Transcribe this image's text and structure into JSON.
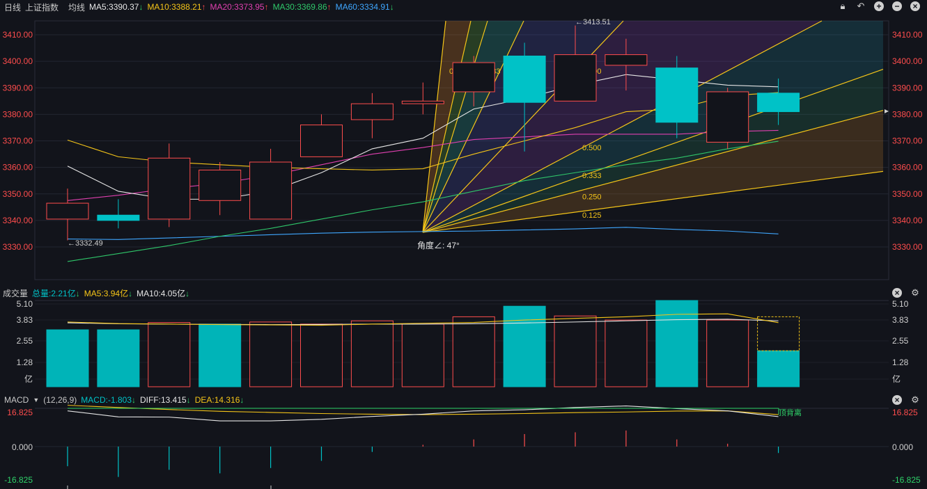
{
  "header": {
    "period": "日线",
    "index_name": "上证指数",
    "ma_label": "均线",
    "ma_items": [
      {
        "text": "MA5:3390.37",
        "arrow": "↓",
        "color": "#e6e6e6",
        "arrow_color": "#2fd36a"
      },
      {
        "text": "MA10:3388.21",
        "arrow": "↑",
        "color": "#f5c518",
        "arrow_color": "#ff4d4d"
      },
      {
        "text": "MA20:3373.95",
        "arrow": "↑",
        "color": "#e040b0",
        "arrow_color": "#ff4d4d"
      },
      {
        "text": "MA30:3369.86",
        "arrow": "↑",
        "color": "#2fc76a",
        "arrow_color": "#ff4d4d"
      },
      {
        "text": "MA60:3334.91",
        "arrow": "↓",
        "color": "#3fa7ff",
        "arrow_color": "#2fd36a"
      }
    ],
    "icons": [
      "lock-icon",
      "undo-icon",
      "zoom-in-icon",
      "zoom-out-icon",
      "close-icon"
    ]
  },
  "volume_header": {
    "label": "成交量",
    "items": [
      {
        "text": "总量:2.21亿",
        "arrow": "↓",
        "color": "#00c2c7"
      },
      {
        "text": "MA5:3.94亿",
        "arrow": "↓",
        "color": "#f5c518"
      },
      {
        "text": "MA10:4.05亿",
        "arrow": "↓",
        "color": "#e6e6e6"
      }
    ]
  },
  "macd_header": {
    "label": "MACD",
    "params": "(12,26,9)",
    "items": [
      {
        "text": "MACD:-1.803",
        "arrow": "↓",
        "color": "#00c2c7"
      },
      {
        "text": "DIFF:13.415",
        "arrow": "↓",
        "color": "#e6e6e6"
      },
      {
        "text": "DEA:14.316",
        "arrow": "↓",
        "color": "#f5c518"
      }
    ]
  },
  "chart_data": [
    {
      "type": "candlestick",
      "yticks": [
        "3410.00",
        "3400.00",
        "3390.00",
        "3380.00",
        "3370.00",
        "3360.00",
        "3350.00",
        "3340.00",
        "3330.00"
      ],
      "ylim": [
        3322,
        3418
      ],
      "candles": [
        {
          "o": 3340.5,
          "h": 3352,
          "l": 3332.5,
          "c": 3346.5
        },
        {
          "o": 3342,
          "h": 3348,
          "l": 3337,
          "c": 3340
        },
        {
          "o": 3340.5,
          "h": 3369,
          "l": 3337.5,
          "c": 3363.5
        },
        {
          "o": 3347.5,
          "h": 3362,
          "l": 3342,
          "c": 3359
        },
        {
          "o": 3340.5,
          "h": 3367,
          "l": 3340.5,
          "c": 3362
        },
        {
          "o": 3364,
          "h": 3380,
          "l": 3364,
          "c": 3376
        },
        {
          "o": 3378,
          "h": 3388,
          "l": 3371,
          "c": 3384
        },
        {
          "o": 3384,
          "h": 3392,
          "l": 3380,
          "c": 3385
        },
        {
          "o": 3388.5,
          "h": 3402,
          "l": 3383,
          "c": 3399.5
        },
        {
          "o": 3402,
          "h": 3407,
          "l": 3366,
          "c": 3384.5
        },
        {
          "o": 3385,
          "h": 3413.51,
          "l": 3385,
          "c": 3402.5
        },
        {
          "o": 3398.5,
          "h": 3408.5,
          "l": 3389,
          "c": 3402.5
        },
        {
          "o": 3397.5,
          "h": 3402,
          "l": 3371,
          "c": 3377
        },
        {
          "o": 3369.5,
          "h": 3390,
          "l": 3367,
          "c": 3388.5
        },
        {
          "o": 3388,
          "h": 3393.5,
          "l": 3376,
          "c": 3381
        }
      ],
      "ma5": [
        3360.5,
        3351,
        3348,
        3348,
        3351,
        3358,
        3367,
        3371,
        3382,
        3386,
        3391,
        3395,
        3393,
        3391,
        3390.37
      ],
      "ma10": [
        3370.3,
        3364,
        3362,
        3361,
        3360,
        3359.5,
        3359,
        3359.5,
        3365,
        3370,
        3375,
        3381,
        3382,
        3387,
        3388.21
      ],
      "ma20_start": [
        0,
        3347.5
      ],
      "ma20_end": [
        14,
        3374
      ],
      "ma20": [
        3347.5,
        3349.5,
        3352,
        3354,
        3357,
        3361,
        3365,
        3367.5,
        3370.5,
        3371.5,
        3372.5,
        3372.5,
        3372.5,
        3373.5,
        3373.95
      ],
      "ma30": [
        3324.5,
        3327.5,
        3330.5,
        3334,
        3337,
        3340.5,
        3344,
        3347,
        3351,
        3355,
        3358,
        3361,
        3363.5,
        3367,
        3369.86
      ],
      "ma60": [
        3333,
        3332.8,
        3333.4,
        3334,
        3334.6,
        3335.2,
        3335.6,
        3335.8,
        3336,
        3336.4,
        3336.8,
        3337.4,
        3336.6,
        3336,
        3334.91
      ],
      "annotations": {
        "high_label": "←3413.51",
        "low_label": "←3332.49",
        "angle_label": "角度∠: 47°",
        "fan_labels": [
          "0.125",
          "0.250",
          "0.333",
          "0.500",
          "1.000"
        ],
        "fan_labels_right": [
          "0.500",
          "0.333",
          "0.250",
          "0.125"
        ]
      }
    },
    {
      "type": "bar",
      "title": "成交量",
      "yticks": [
        "5.10",
        "3.83",
        "2.55",
        "1.28",
        "亿"
      ],
      "ylim": [
        0,
        5.3
      ],
      "values": [
        3.5,
        3.5,
        3.95,
        3.85,
        3.98,
        3.85,
        4.05,
        3.85,
        4.3,
        4.95,
        4.35,
        4.1,
        5.3,
        4.1,
        2.21
      ],
      "up": [
        false,
        false,
        true,
        false,
        true,
        true,
        true,
        true,
        true,
        false,
        true,
        true,
        false,
        true,
        false
      ],
      "ma5": [
        3.98,
        3.88,
        3.85,
        3.82,
        3.8,
        3.78,
        3.85,
        3.9,
        3.95,
        4.1,
        4.2,
        4.3,
        4.45,
        4.48,
        3.94
      ],
      "ma10": [
        3.93,
        3.87,
        3.85,
        3.83,
        3.82,
        3.83,
        3.85,
        3.85,
        3.87,
        3.92,
        3.98,
        4.05,
        4.12,
        4.15,
        4.05
      ]
    },
    {
      "type": "macd",
      "yticks": [
        "16.825",
        "0.000",
        "-16.825"
      ],
      "ylim": [
        -16.825,
        16.825
      ],
      "diff": [
        16.0,
        13.3,
        13.2,
        11.5,
        11.5,
        12.2,
        13.5,
        14.5,
        16.0,
        16.5,
        17.5,
        18.2,
        17.0,
        16.0,
        13.415
      ],
      "dea": [
        18.5,
        17.5,
        16.6,
        15.8,
        15.3,
        14.8,
        14.5,
        14.3,
        14.5,
        14.8,
        15.2,
        15.5,
        15.9,
        16.0,
        14.316
      ],
      "macd": [
        -5.5,
        -8.5,
        -6.5,
        -7.5,
        -6,
        -4,
        -1.5,
        0.5,
        2,
        3.5,
        4,
        4.5,
        2,
        0.8,
        -1.803
      ],
      "divergence_label": "顶背离"
    }
  ]
}
